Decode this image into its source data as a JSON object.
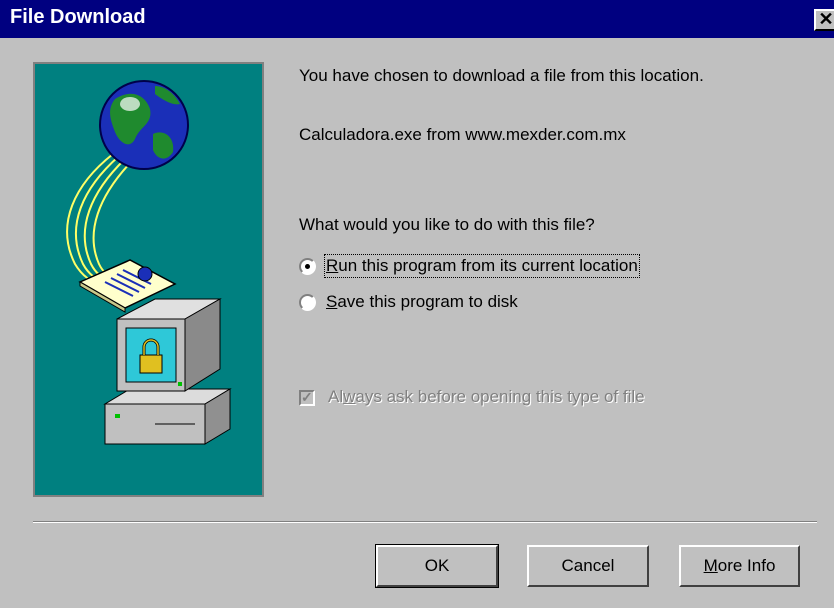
{
  "window": {
    "title": "File Download",
    "close_symbol": "✕"
  },
  "message": {
    "line1": "You have chosen to download a file from this location.",
    "source": "Calculadora.exe from www.mexder.com.mx",
    "question": "What would you like to do with this file?"
  },
  "options": [
    {
      "mnemonic": "R",
      "rest": "un this program from its current location",
      "selected": true
    },
    {
      "mnemonic": "S",
      "rest": "ave this program to disk",
      "selected": false
    }
  ],
  "checkbox": {
    "pre": "Al",
    "mnemonic": "w",
    "rest": "ays ask before opening this type of file",
    "checked": true,
    "disabled": true
  },
  "buttons": {
    "ok": "OK",
    "cancel": "Cancel",
    "more_info_mnemonic": "M",
    "more_info_rest": "ore Info"
  },
  "colors": {
    "title_bar": "#000080",
    "illustration_bg": "#008080",
    "face": "#c0c0c0"
  },
  "icons": [
    "globe-icon",
    "document-icon",
    "computer-lock-icon",
    "close-icon"
  ]
}
